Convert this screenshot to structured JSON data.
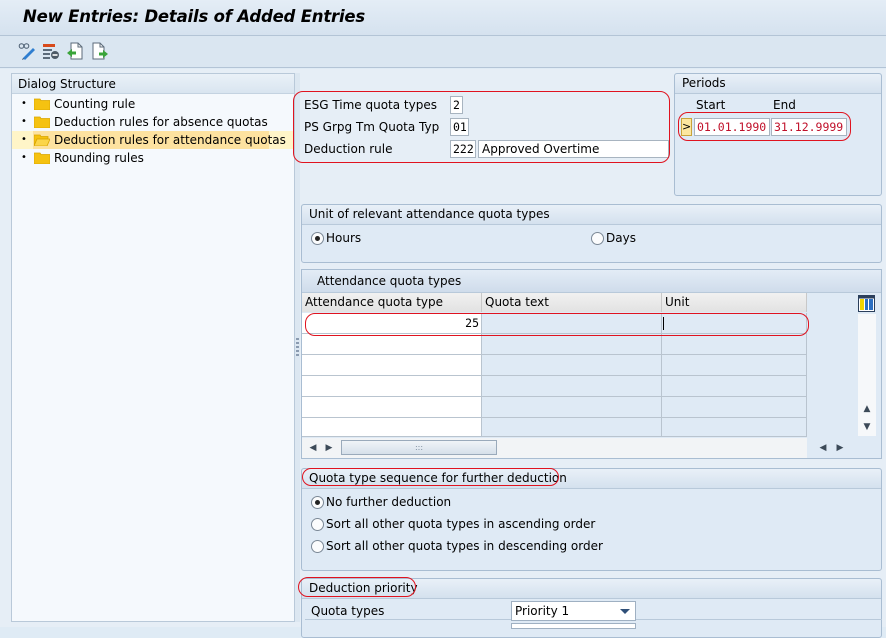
{
  "title": "New Entries: Details of Added Entries",
  "toolbar": {
    "icons": [
      "display-change-icon",
      "delete-icon",
      "previous-entry-icon",
      "next-entry-icon"
    ]
  },
  "dialog_structure": {
    "header": "Dialog Structure",
    "items": [
      {
        "label": "Counting rule",
        "selected": false
      },
      {
        "label": "Deduction rules for absence quotas",
        "selected": false
      },
      {
        "label": "Deduction rules for attendance quotas",
        "selected": true
      },
      {
        "label": "Rounding rules",
        "selected": false
      }
    ]
  },
  "key_fields": {
    "esg_label": "ESG Time quota types",
    "esg_value": "2",
    "psgrpg_label": "PS Grpg Tm Quota Typ",
    "psgrpg_value": "01",
    "deduction_rule_label": "Deduction rule",
    "deduction_rule_value": "222",
    "deduction_rule_text": "Approved Overtime"
  },
  "periods": {
    "title": "Periods",
    "start_label": "Start",
    "end_label": "End",
    "nav_button": ">",
    "start_value": "01.01.1990",
    "end_value": "31.12.9999"
  },
  "unit_group": {
    "title": "Unit of relevant attendance quota types",
    "options": [
      {
        "label": "Hours",
        "selected": true
      },
      {
        "label": "Days",
        "selected": false
      }
    ]
  },
  "attendance_table": {
    "title": "Attendance quota types",
    "columns": [
      "Attendance quota type",
      "Quota text",
      "Unit"
    ],
    "rows": [
      {
        "type": "25",
        "text": "",
        "unit": ""
      },
      {
        "type": "",
        "text": "",
        "unit": ""
      },
      {
        "type": "",
        "text": "",
        "unit": ""
      },
      {
        "type": "",
        "text": "",
        "unit": ""
      },
      {
        "type": "",
        "text": "",
        "unit": ""
      },
      {
        "type": "",
        "text": "",
        "unit": ""
      }
    ],
    "hscroll_grip": ":::"
  },
  "sequence_group": {
    "title": "Quota type sequence for further deduction",
    "options": [
      {
        "label": "No further deduction",
        "selected": true
      },
      {
        "label": "Sort all other quota types in ascending order",
        "selected": false
      },
      {
        "label": "Sort all other quota types in descending order",
        "selected": false
      }
    ]
  },
  "priority_group": {
    "title": "Deduction priority",
    "quota_types_label": "Quota types",
    "quota_types_value": "Priority 1"
  },
  "colors": {
    "highlight_outline": "#e0131f",
    "selected_tree_item": "#fde2a0",
    "date_text": "#c0102a"
  }
}
